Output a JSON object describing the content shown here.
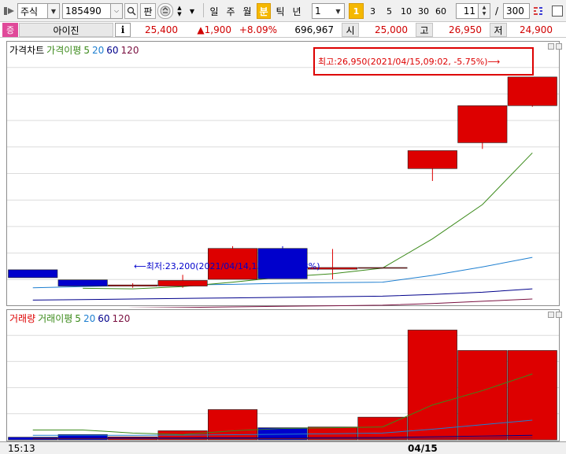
{
  "toolbar": {
    "market_select": "주식",
    "code_input": "185490",
    "search_label": "판",
    "periods": [
      "일",
      "주",
      "월",
      "분",
      "틱",
      "년"
    ],
    "active_period": "분",
    "interval_select": "1",
    "intervals": [
      "1",
      "3",
      "5",
      "10",
      "30",
      "60"
    ],
    "active_interval": "1",
    "count_value": "11",
    "slash": "/",
    "total_value": "300"
  },
  "quote": {
    "badge": "증",
    "name": "아이진",
    "info_label": "i",
    "price": "25,400",
    "change": "▲1,900",
    "change_rate": "+8.09%",
    "volume": "696,967",
    "open_label": "시",
    "open": "25,000",
    "high_label": "고",
    "high": "26,950",
    "low_label": "저",
    "low": "24,900"
  },
  "colors": {
    "up": "#dd0000",
    "down": "#0000cc",
    "ma5": "#3b8a1a",
    "ma20": "#1e7fd0",
    "ma60": "#00008b",
    "ma120": "#7a1040",
    "highlight_box": "#dd0000"
  },
  "price_panel": {
    "legend": {
      "title": "가격차트",
      "ma_label": "가격이평",
      "ma5": "5",
      "ma20": "20",
      "ma60": "60",
      "ma120": "120"
    },
    "high_annotation": "최고:26,950(2021/04/15,09:02, -5.75%)⟶",
    "low_annotation": "⟵최저:23,200(2021/04/14,15:15, +9.48%)"
  },
  "volume_panel": {
    "legend": {
      "title": "거래량",
      "ma_label": "거래이평",
      "ma5": "5",
      "ma20": "20",
      "ma60": "60",
      "ma120": "120"
    }
  },
  "axis": {
    "left_label": "15:13",
    "date_label": "04/15"
  },
  "chart_data": {
    "type": "candlestick",
    "title": "가격차트",
    "ylim": [
      23000,
      27200
    ],
    "candles": [
      {
        "o": 23520,
        "h": 23520,
        "l": 23380,
        "c": 23380
      },
      {
        "o": 23340,
        "h": 23340,
        "l": 23230,
        "c": 23230
      },
      {
        "o": 23230,
        "h": 23280,
        "l": 23200,
        "c": 23250
      },
      {
        "o": 23230,
        "h": 23430,
        "l": 23200,
        "c": 23330
      },
      {
        "o": 23350,
        "h": 23940,
        "l": 23350,
        "c": 23900
      },
      {
        "o": 23900,
        "h": 23940,
        "l": 23360,
        "c": 23360
      },
      {
        "o": 23530,
        "h": 23890,
        "l": 23350,
        "c": 23560
      },
      {
        "o": 23560,
        "h": 23560,
        "l": 23560,
        "c": 23560
      },
      {
        "o": 25320,
        "h": 25620,
        "l": 25100,
        "c": 25640
      },
      {
        "o": 25780,
        "h": 26410,
        "l": 25670,
        "c": 26440
      },
      {
        "o": 26440,
        "h": 26950,
        "l": 26420,
        "c": 26950
      }
    ],
    "ma5": [
      null,
      23190,
      23180,
      23220,
      23300,
      23390,
      23450,
      23550,
      24070,
      24680,
      25600
    ],
    "ma20": [
      23200,
      23220,
      23240,
      23250,
      23260,
      23280,
      23290,
      23300,
      23420,
      23570,
      23740
    ],
    "ma60": [
      22980,
      22990,
      23000,
      23010,
      23020,
      23030,
      23040,
      23050,
      23080,
      23120,
      23180
    ],
    "ma120": [
      22820,
      22830,
      22840,
      22850,
      22860,
      22870,
      22880,
      22890,
      22920,
      22960,
      23000
    ],
    "volume": {
      "ylim": [
        0,
        160000
      ],
      "values": [
        3500,
        7000,
        4000,
        12000,
        40000,
        16000,
        17000,
        30000,
        145000,
        118000,
        118000
      ],
      "ma5": [
        13000,
        13000,
        9000,
        7000,
        12000,
        15000,
        16000,
        17000,
        46000,
        65000,
        87000
      ],
      "ma20": [
        6000,
        6000,
        6000,
        6200,
        6800,
        7400,
        8000,
        9000,
        14000,
        20000,
        26000
      ],
      "ma60": [
        2500,
        2500,
        2500,
        2500,
        2600,
        2700,
        2800,
        3000,
        4000,
        5000,
        6000
      ],
      "ma120": [
        1500,
        1500,
        1500,
        1500,
        1500,
        1600,
        1600,
        1700,
        2000,
        2500,
        3000
      ]
    }
  }
}
